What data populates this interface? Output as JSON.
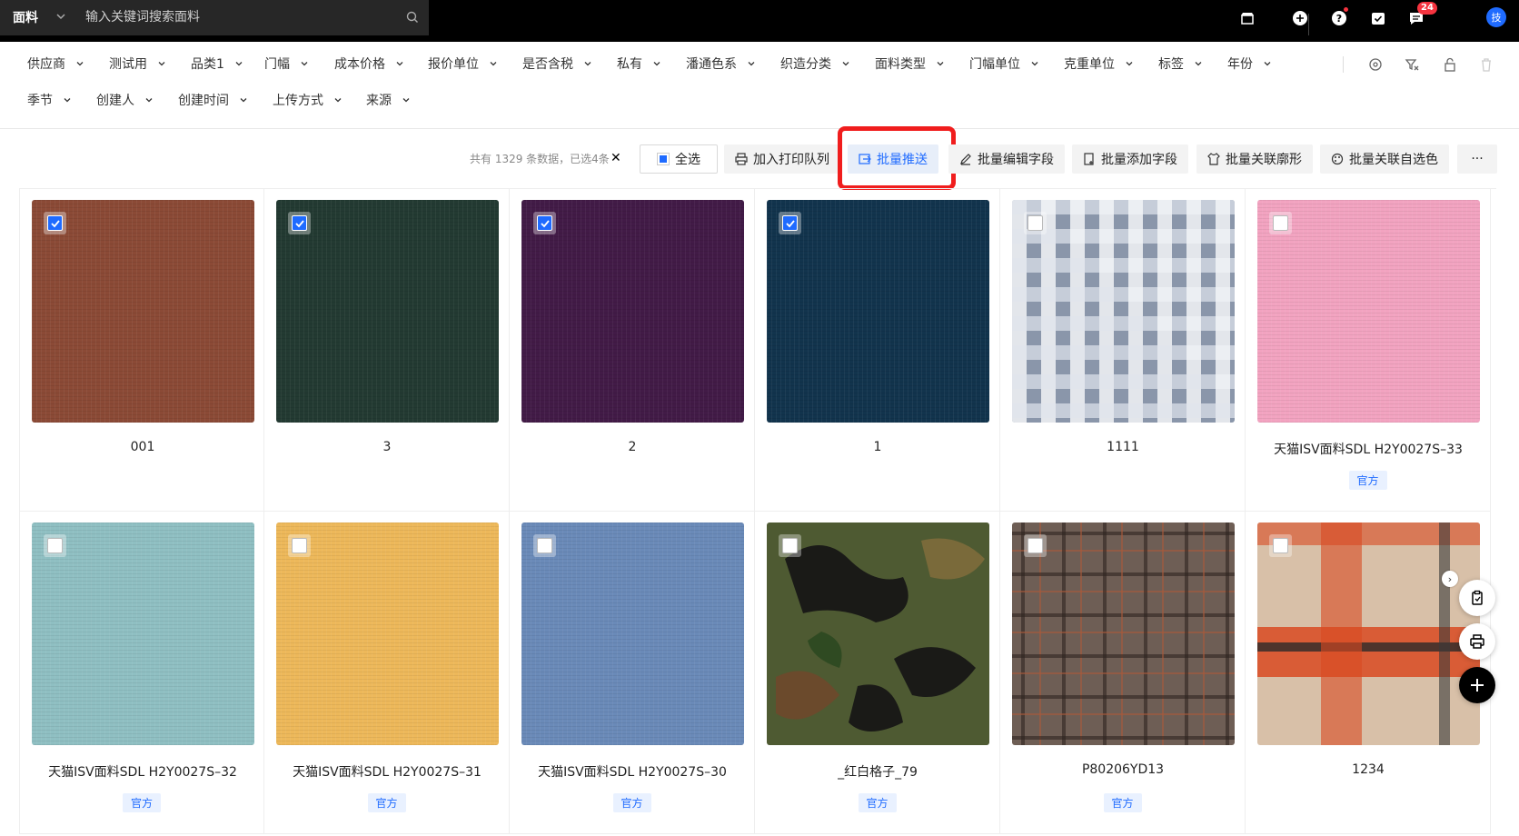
{
  "topbar": {
    "scope": "面料",
    "search_placeholder": "输入关键词搜索面料",
    "message_badge": "24",
    "avatar_text": "技"
  },
  "filters": [
    {
      "label": "供应商"
    },
    {
      "label": "测试用"
    },
    {
      "label": "品类1"
    },
    {
      "label": "门幅"
    },
    {
      "label": "成本价格"
    },
    {
      "label": "报价单位"
    },
    {
      "label": "是否含税"
    },
    {
      "label": "私有"
    },
    {
      "label": "潘通色系"
    },
    {
      "label": "织造分类"
    },
    {
      "label": "面料类型"
    },
    {
      "label": "门幅单位"
    },
    {
      "label": "克重单位"
    },
    {
      "label": "标签"
    },
    {
      "label": "年份"
    },
    {
      "label": "季节"
    },
    {
      "label": "创建人"
    },
    {
      "label": "创建时间"
    },
    {
      "label": "上传方式"
    },
    {
      "label": "来源"
    }
  ],
  "actions": {
    "summary": "共有 1329 条数据，已选4条",
    "select_all": "全选",
    "add_print_queue": "加入打印队列",
    "batch_push": "批量推送",
    "batch_edit_fields": "批量编辑字段",
    "batch_add_fields": "批量添加字段",
    "batch_link_silhouette": "批量关联廓形",
    "batch_link_color": "批量关联自选色",
    "more": "···"
  },
  "cards": [
    {
      "name": "001",
      "checked": true,
      "tag": "",
      "swatch": "#8b4a36"
    },
    {
      "name": "3",
      "checked": true,
      "tag": "",
      "swatch": "#233a32"
    },
    {
      "name": "2",
      "checked": true,
      "tag": "",
      "swatch": "#421b47"
    },
    {
      "name": "1",
      "checked": true,
      "tag": "",
      "swatch": "#12344d"
    },
    {
      "name": "1111",
      "checked": false,
      "tag": "",
      "swatch": "#8a96aa"
    },
    {
      "name": "天猫ISV面料SDL H2Y0027S–33",
      "checked": false,
      "tag": "官方",
      "swatch": "#f2a3c0"
    },
    {
      "name": "天猫ISV面料SDL H2Y0027S–32",
      "checked": false,
      "tag": "官方",
      "swatch": "#8fbfc2"
    },
    {
      "name": "天猫ISV面料SDL H2Y0027S–31",
      "checked": false,
      "tag": "官方",
      "swatch": "#edb85a"
    },
    {
      "name": "天猫ISV面料SDL H2Y0027S–30",
      "checked": false,
      "tag": "官方",
      "swatch": "#6a8ab8"
    },
    {
      "name": "_红白格子_79",
      "checked": false,
      "tag": "官方",
      "swatch": "#4e5a32"
    },
    {
      "name": "P80206YD13",
      "checked": false,
      "tag": "官方",
      "swatch": "#6e5e55"
    },
    {
      "name": "1234",
      "checked": false,
      "tag": "",
      "swatch": "#d8c0a8"
    }
  ]
}
